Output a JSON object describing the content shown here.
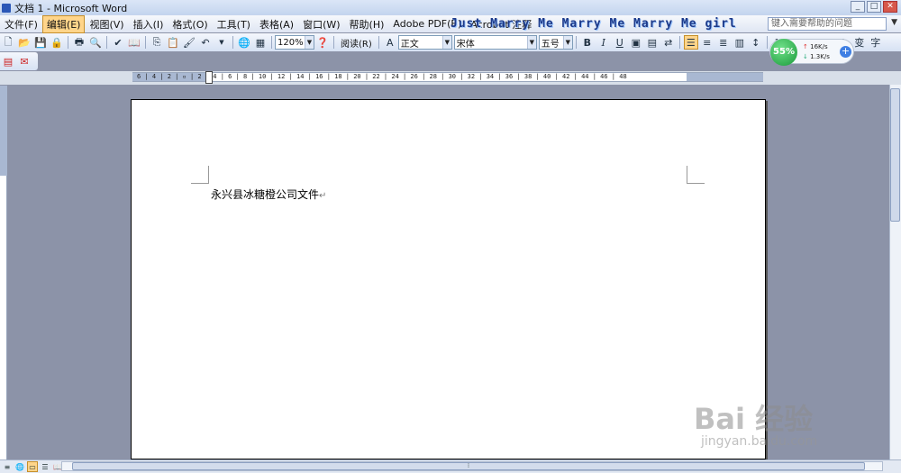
{
  "window": {
    "title": "文档 1 - Microsoft Word"
  },
  "menu": {
    "items": [
      "文件(F)",
      "编辑(E)",
      "视图(V)",
      "插入(I)",
      "格式(O)",
      "工具(T)",
      "表格(A)",
      "窗口(W)",
      "帮助(H)",
      "Adobe PDF(B)",
      "Acrobat 注释"
    ],
    "active_index": 1,
    "marquee": "Just Marry Me Marry Me Marry Me girl",
    "help_placeholder": "键入需要帮助的问题"
  },
  "toolbar": {
    "zoom": "120%",
    "read_label": "阅读(R)",
    "style": "正文",
    "font": "宋体",
    "size": "五号",
    "bold": "B",
    "italic": "I",
    "underline": "U"
  },
  "network": {
    "percent": "55%",
    "upload": "16K/s",
    "download": "1.3K/s"
  },
  "ruler": {
    "labels": "6 | 4 | 2 | ▫ | 2 | 4 | 6 | 8 | 10 | 12 | 14 | 16 | 18 | 20 | 22 | 24 | 26 | 28 | 30 | 32 | 34 | 36 | 38 | 40 | 42 | 44 | 46 | 48"
  },
  "document": {
    "text": "永兴县冰糖橙公司文件"
  },
  "watermark": {
    "brand": "Bai 经验",
    "url": "jingyan.baidu.com"
  }
}
